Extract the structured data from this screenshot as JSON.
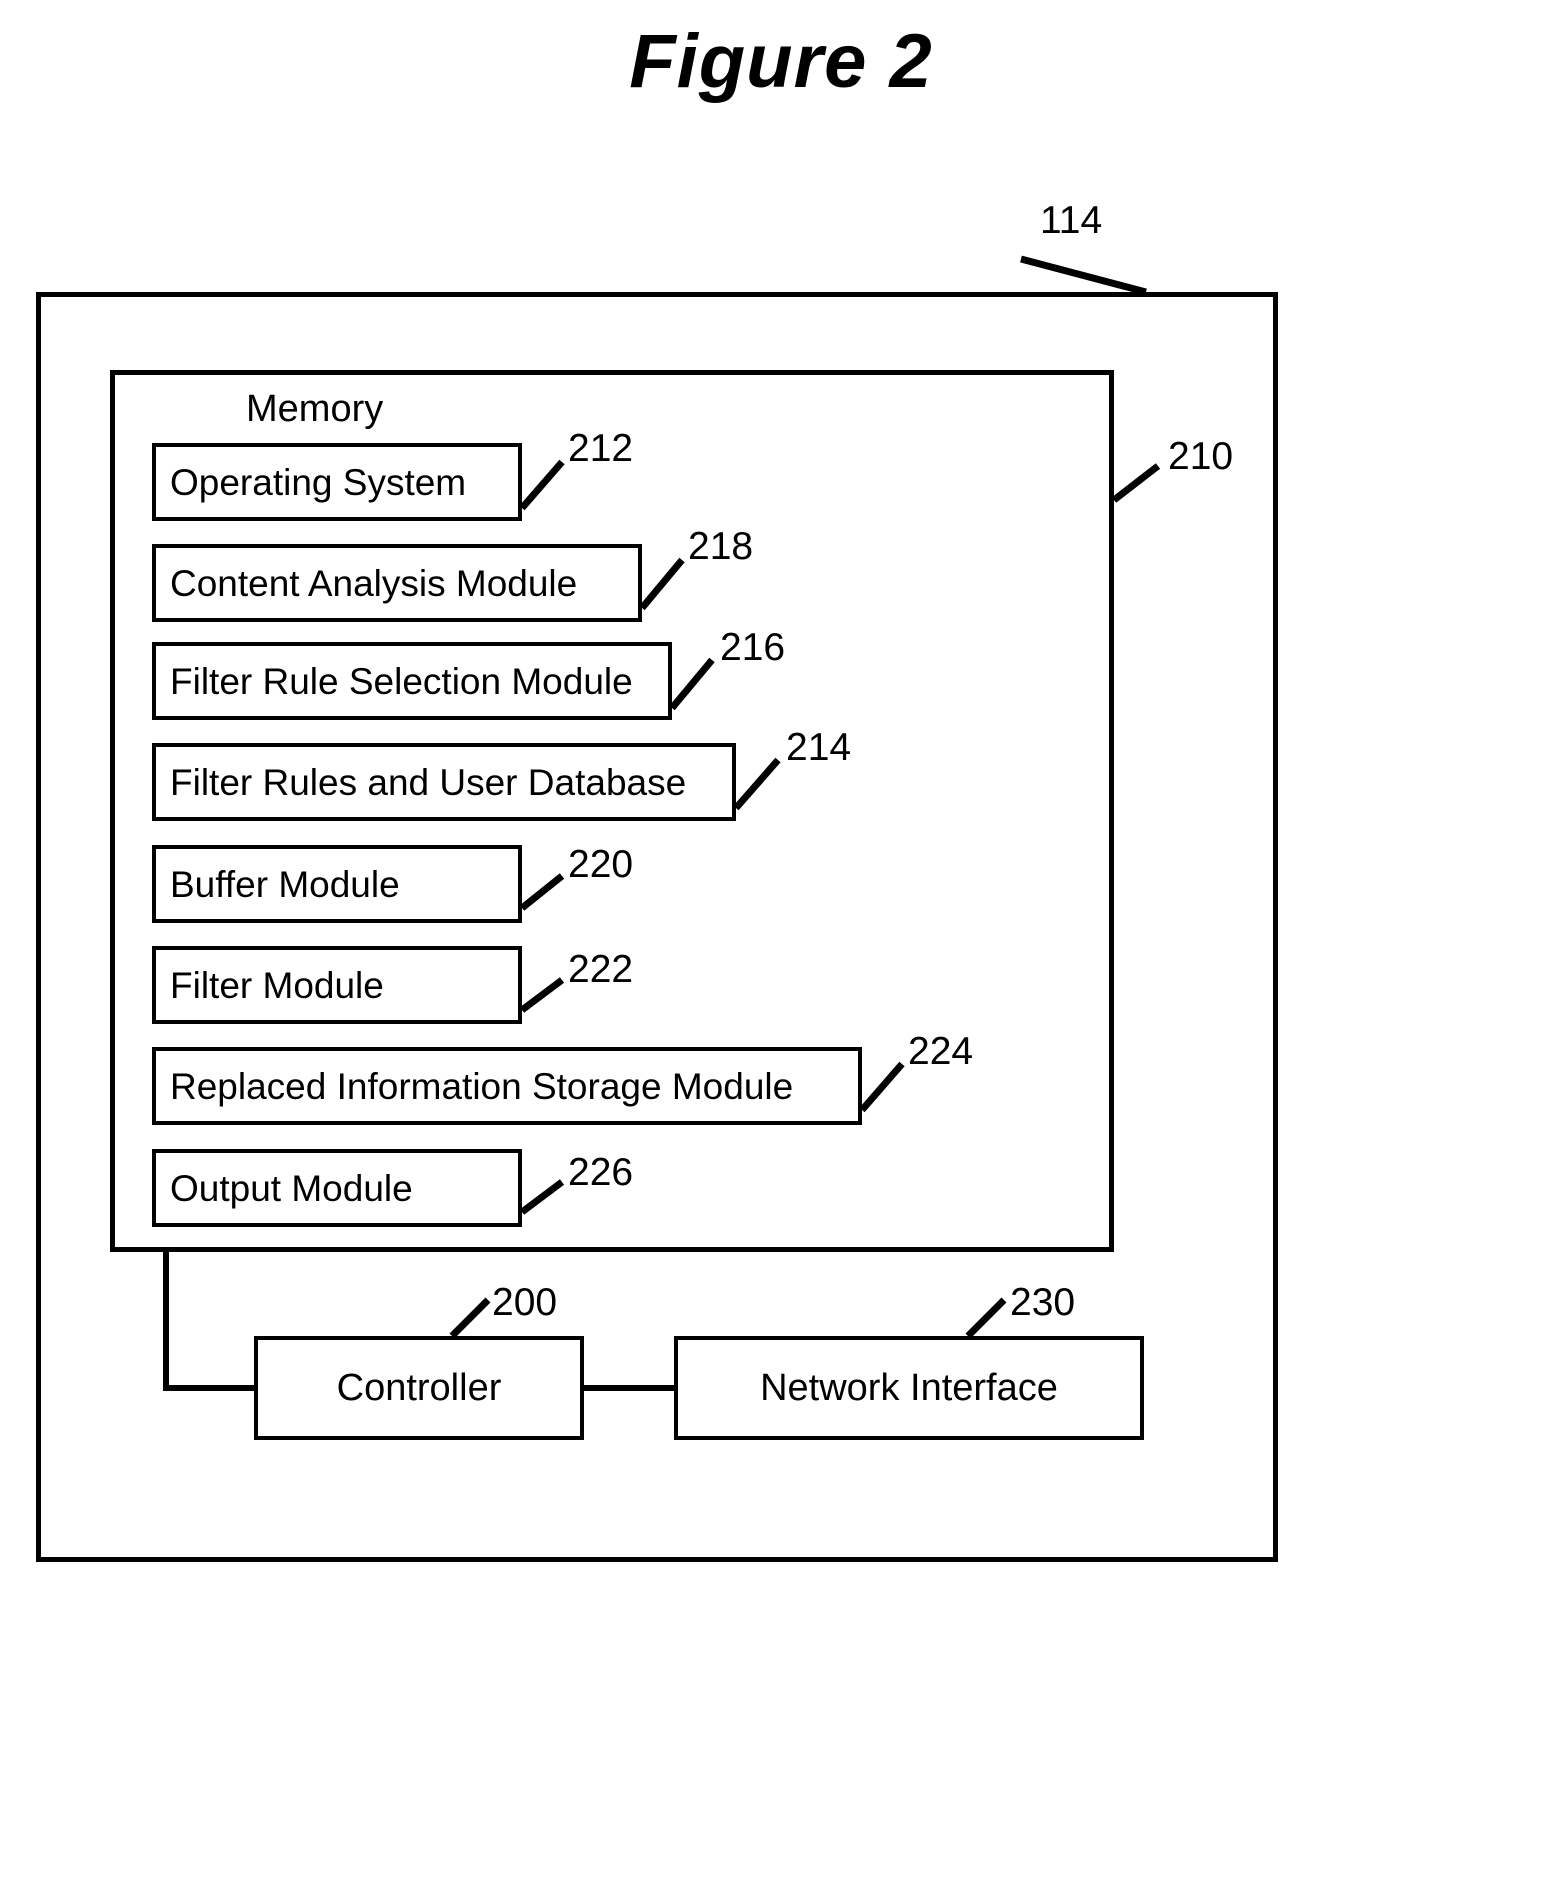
{
  "figure": {
    "title": "Figure 2",
    "outer_ref": "114",
    "memory_ref": "210",
    "memory_caption": "Memory"
  },
  "memory": {
    "modules": [
      {
        "label": "Operating System",
        "ref": "212"
      },
      {
        "label": "Content Analysis Module",
        "ref": "218"
      },
      {
        "label": "Filter Rule Selection Module",
        "ref": "216"
      },
      {
        "label": "Filter Rules and User Database",
        "ref": "214"
      },
      {
        "label": "Buffer Module",
        "ref": "220"
      },
      {
        "label": "Filter Module",
        "ref": "222"
      },
      {
        "label": "Replaced Information Storage Module",
        "ref": "224"
      },
      {
        "label": "Output Module",
        "ref": "226"
      }
    ]
  },
  "bottom": {
    "blocks": [
      {
        "label": "Controller",
        "ref": "200"
      },
      {
        "label": "Network Interface",
        "ref": "230"
      }
    ]
  },
  "colors": {
    "ink": "#000000",
    "paper": "#ffffff"
  }
}
